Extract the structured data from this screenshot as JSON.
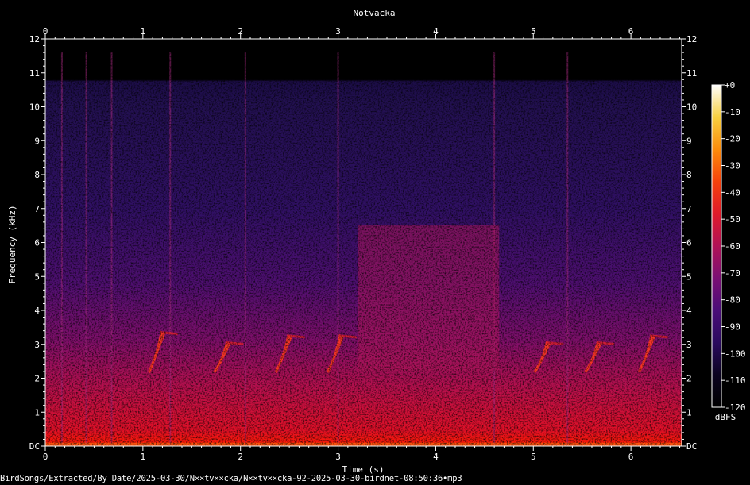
{
  "chart_data": {
    "type": "heatmap",
    "title": "Notvacka",
    "xlabel": "Time (s)",
    "ylabel": "Frequency (kHz)",
    "xlim": [
      0,
      6.52
    ],
    "ylim": [
      0,
      12
    ],
    "x_ticks": [
      "0",
      "1",
      "2",
      "3",
      "4",
      "5",
      "6"
    ],
    "y_ticks": [
      "DC",
      "1",
      "2",
      "3",
      "4",
      "5",
      "6",
      "7",
      "8",
      "9",
      "10",
      "11",
      "12"
    ],
    "colorbar": {
      "label": "dBFS",
      "range": [
        -120,
        0
      ],
      "ticks": [
        "+0",
        "-10",
        "-20",
        "-30",
        "-40",
        "-50",
        "-60",
        "-70",
        "-80",
        "-90",
        "-100",
        "-110",
        "-120"
      ],
      "colormap": [
        "#000000",
        "#0b0320",
        "#2a0a5e",
        "#5a0f7a",
        "#8c0f6e",
        "#c0134a",
        "#e8281c",
        "#f86a0a",
        "#fcae12",
        "#f8e860",
        "#ffffff"
      ]
    },
    "bird_calls": [
      {
        "t": 1.05,
        "f_low": 2.2,
        "f_high": 3.4
      },
      {
        "t": 1.72,
        "f_low": 2.2,
        "f_high": 3.1
      },
      {
        "t": 2.35,
        "f_low": 2.2,
        "f_high": 3.3
      },
      {
        "t": 2.88,
        "f_low": 2.2,
        "f_high": 3.3
      },
      {
        "t": 5.0,
        "f_low": 2.2,
        "f_high": 3.1
      },
      {
        "t": 5.52,
        "f_low": 2.2,
        "f_high": 3.1
      },
      {
        "t": 6.07,
        "f_low": 2.2,
        "f_high": 3.3
      }
    ],
    "broadband_clicks": [
      0.17,
      0.42,
      0.68,
      1.28,
      2.05,
      3.0,
      4.6,
      5.35
    ]
  },
  "footer": "BirdSongs/Extracted/By_Date/2025-03-30/N××tv××cka/N××tv××cka-92-2025-03-30-birdnet-08:50:36•mp3"
}
